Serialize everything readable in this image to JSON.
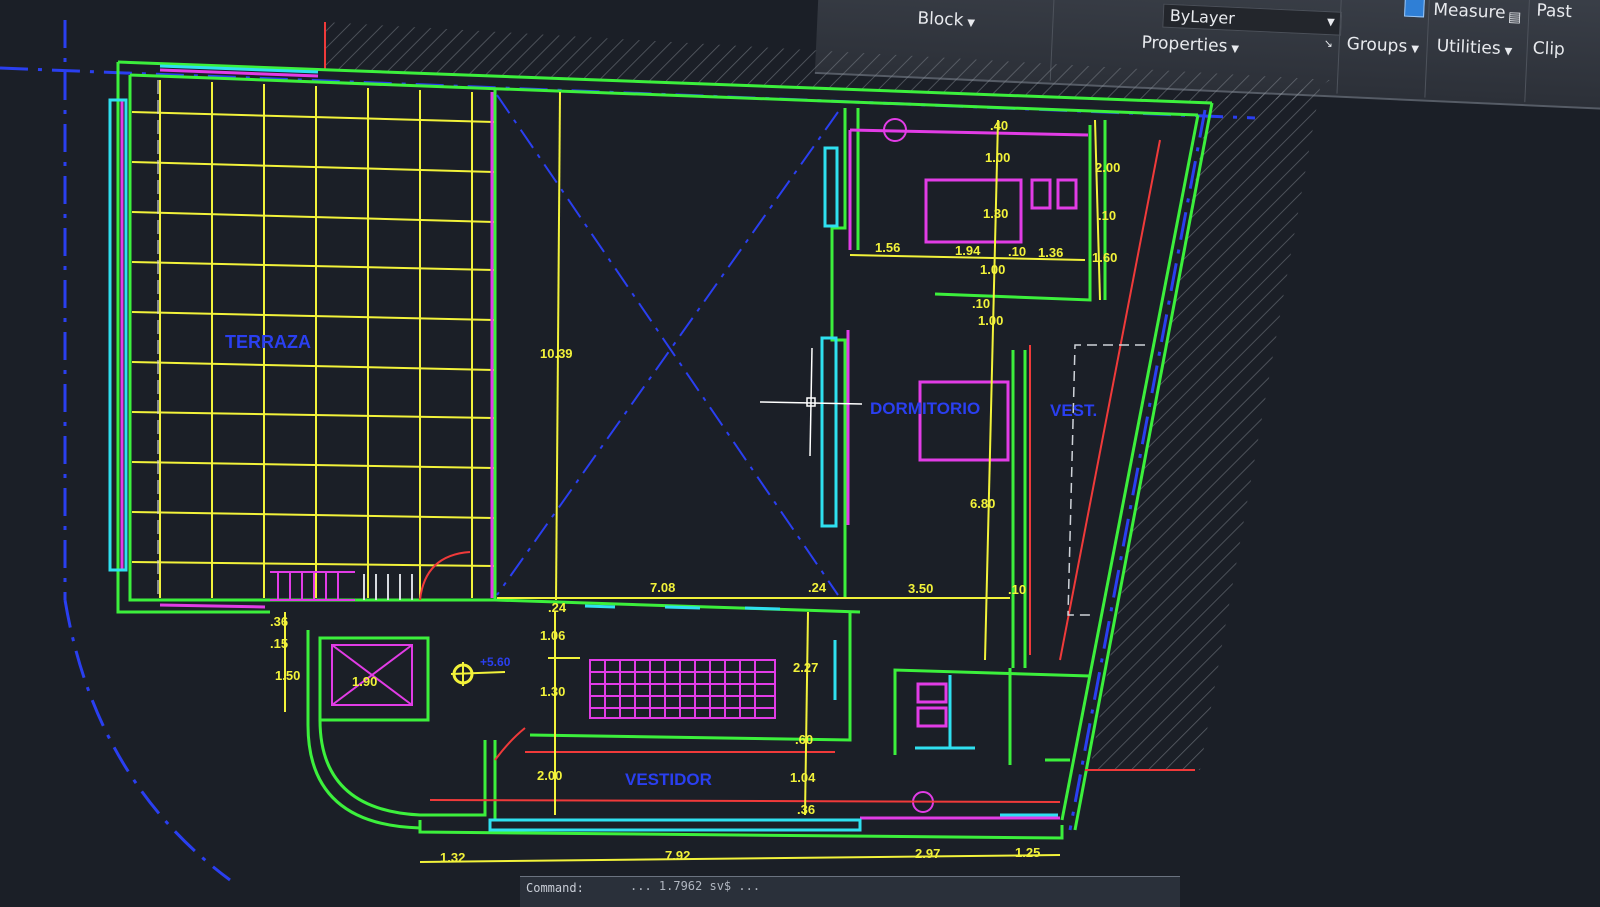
{
  "ribbon": {
    "block_label": "Block",
    "layer_combo": "ByLayer",
    "properties_label": "Properties",
    "groups_label": "Groups",
    "measure_label": "Measure",
    "utilities_label": "Utilities",
    "paste_label": "Past",
    "clipboard_label": "Clip"
  },
  "command": {
    "prompt": "Command:",
    "history": "... 1.7962 sv$ ..."
  },
  "rooms": {
    "terraza": "TERRAZA",
    "dormitorio": "DORMITORIO",
    "vest": "VEST.",
    "vestidor": "VESTIDOR"
  },
  "level_mark": "+5.60",
  "dimensions": {
    "d_40": ".40",
    "d_100a": "1.00",
    "d_200": "2.00",
    "d_130a": "1.30",
    "d_10a": ".10",
    "d_156": "1.56",
    "d_194": "1.94",
    "d_10b": ".10",
    "d_136": "1.36",
    "d_160": "1.60",
    "d_100b": "1.00",
    "d_10c": ".10",
    "d_100c": "1.00",
    "d_1039": "10.39",
    "d_680": "6.80",
    "d_708": "7.08",
    "d_24a": ".24",
    "d_350": "3.50",
    "d_10d": ".10",
    "d_24b": ".24",
    "d_36a": ".36",
    "d_15": ".15",
    "d_150": "1.50",
    "d_190": "1.90",
    "d_106": "1.06",
    "d_130b": "1.30",
    "d_227": "2.27",
    "d_60": ".60",
    "d_200b": "2.00",
    "d_104": "1.04",
    "d_36b": ".36",
    "d_132": "1.32",
    "d_792": "7.92",
    "d_297": "2.97",
    "d_125": "1.25"
  },
  "colors": {
    "background": "#1b1f27",
    "wall_green": "#3cf03c",
    "yellow": "#f2f23a",
    "magenta": "#e23ce6",
    "cyan": "#2fe0f0",
    "blue": "#2a3ff0",
    "red": "#f03a3a",
    "hatch": "#8a9098"
  }
}
